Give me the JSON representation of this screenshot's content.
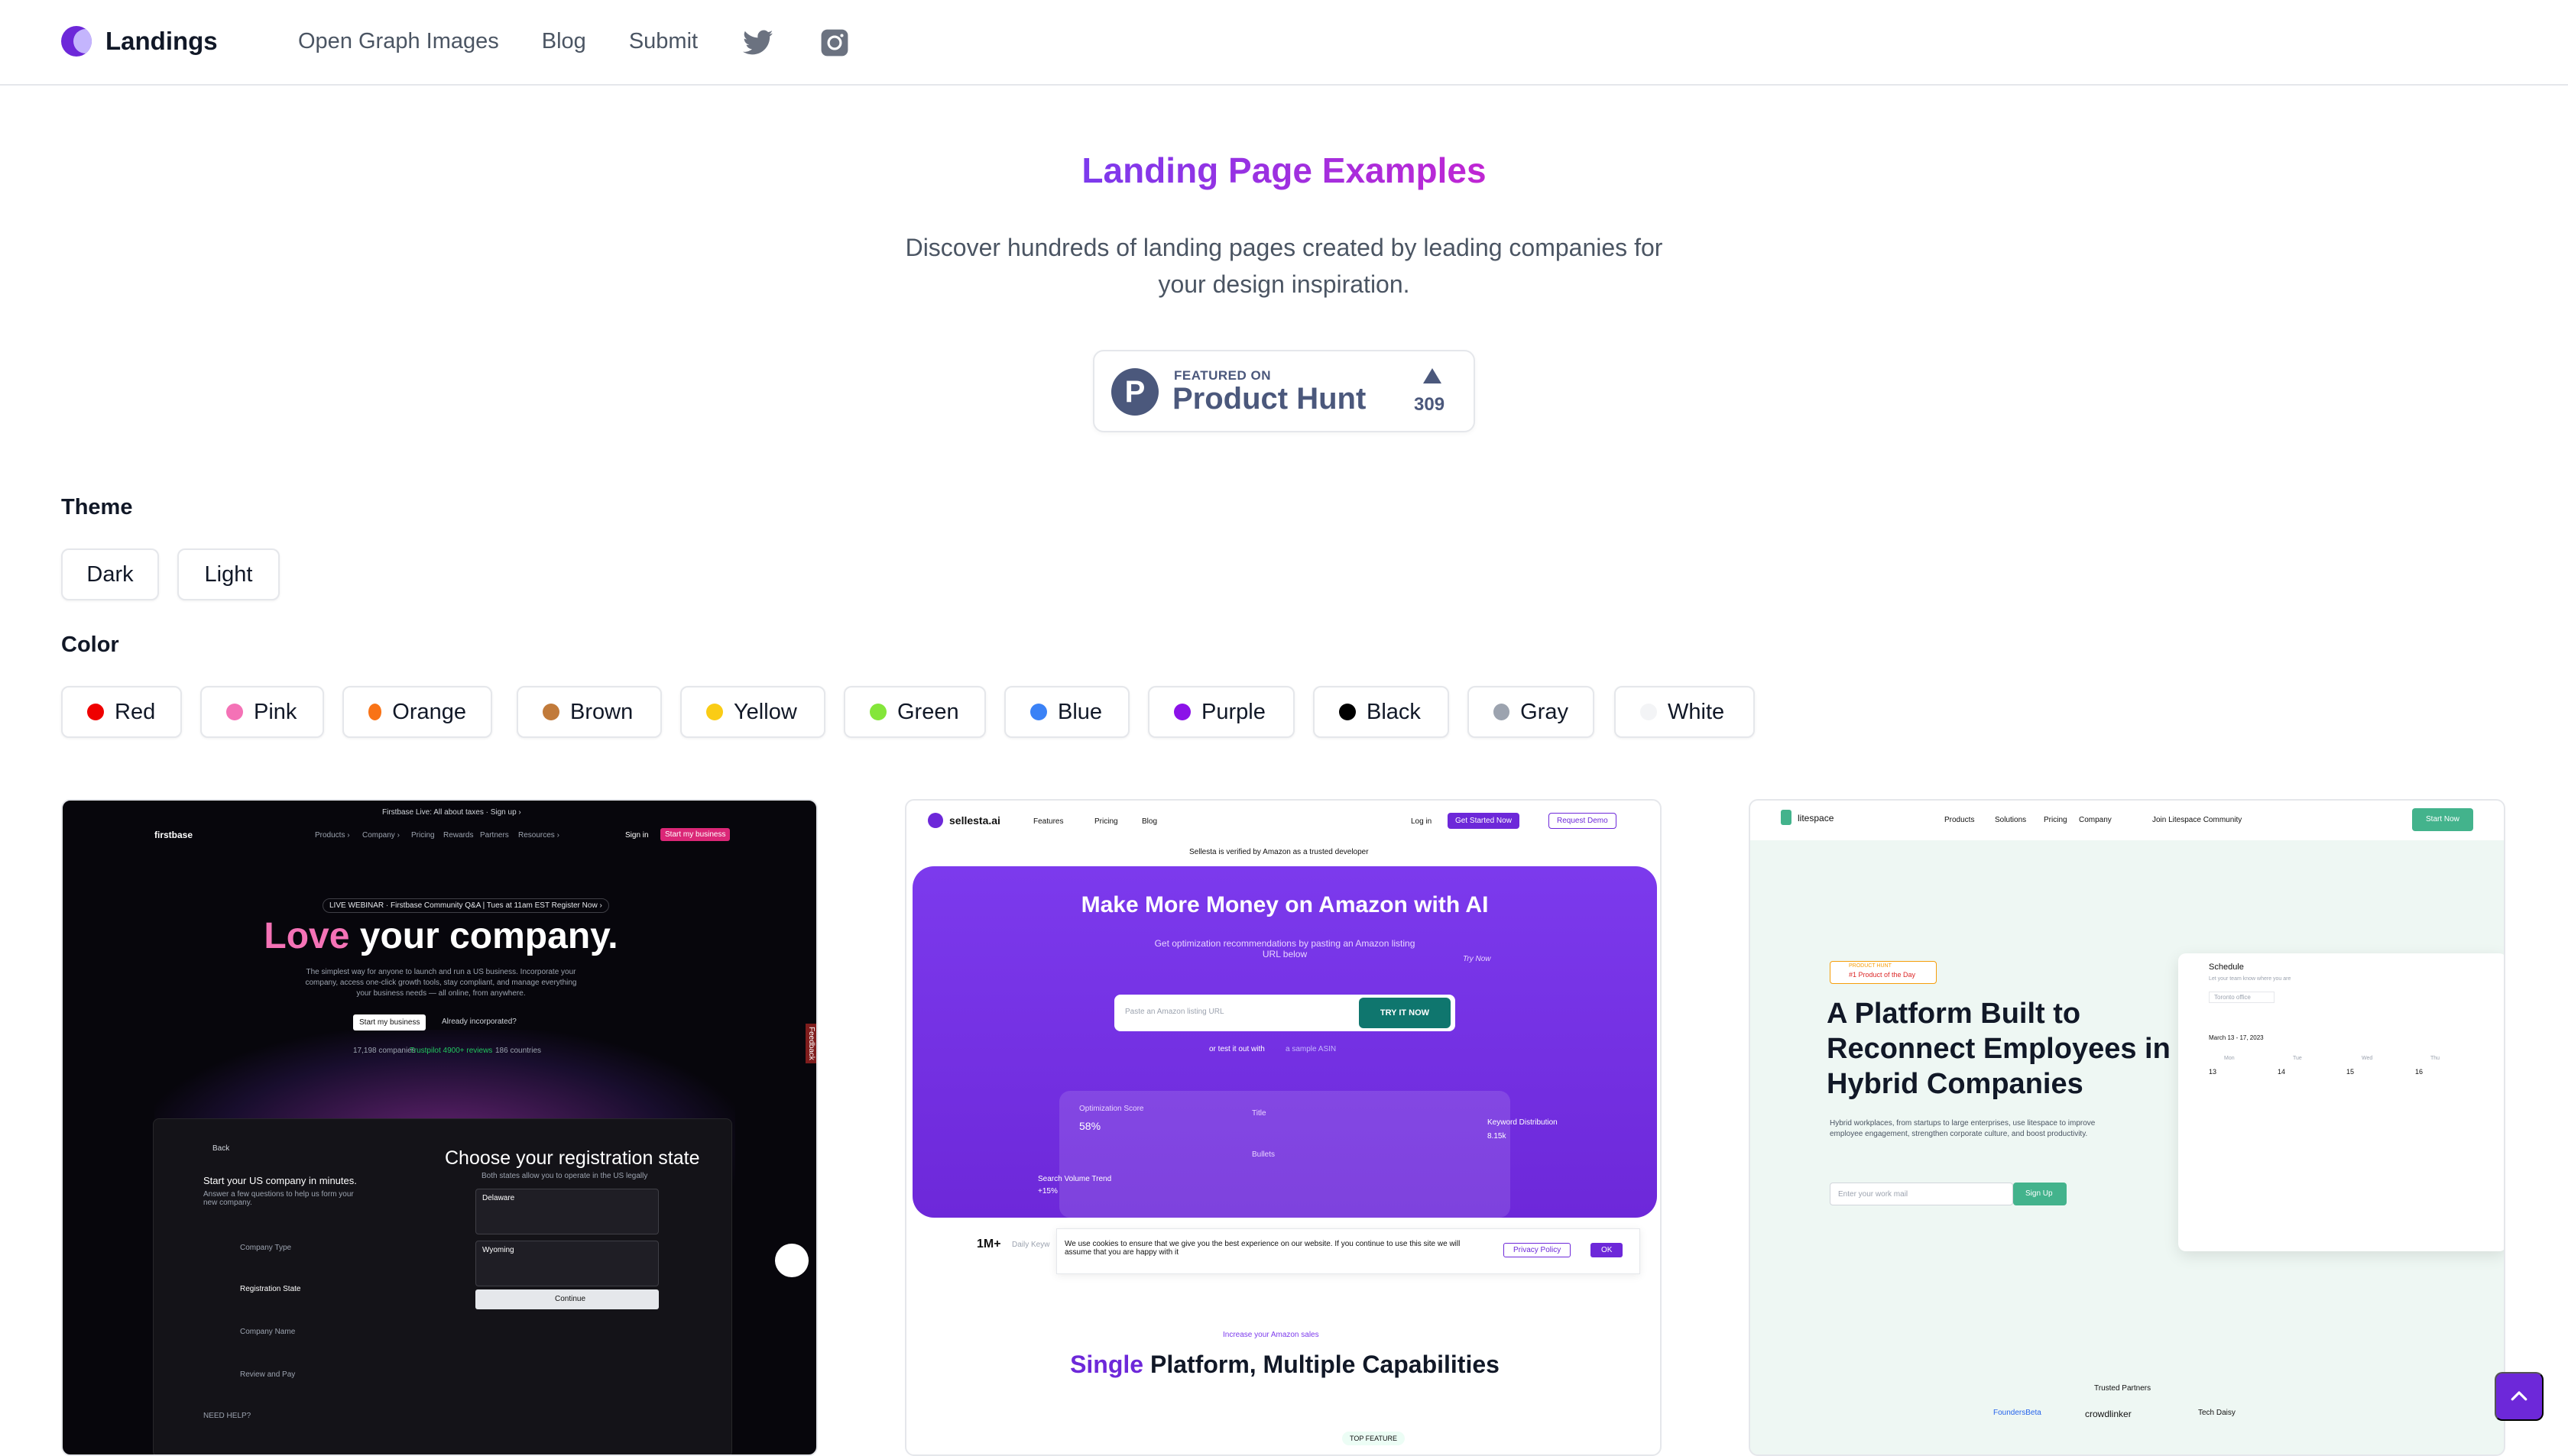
{
  "nav": {
    "brand": "Landings",
    "links": [
      "Open Graph Images",
      "Blog",
      "Submit"
    ],
    "icons": [
      "twitter-icon",
      "instagram-icon"
    ]
  },
  "hero": {
    "title": "Landing Page Examples",
    "subtitle": "Discover hundreds of landing pages created by leading companies for your design inspiration."
  },
  "product_hunt": {
    "featured_on": "FEATURED ON",
    "name": "Product Hunt",
    "upvotes": "309"
  },
  "filters": {
    "theme_label": "Theme",
    "themes": [
      "Dark",
      "Light"
    ],
    "color_label": "Color",
    "colors": [
      {
        "label": "Red",
        "hex": "#ef0000"
      },
      {
        "label": "Pink",
        "hex": "#f472b6"
      },
      {
        "label": "Orange",
        "hex": "#f97316"
      },
      {
        "label": "Brown",
        "hex": "#c17a3a"
      },
      {
        "label": "Yellow",
        "hex": "#facc15"
      },
      {
        "label": "Green",
        "hex": "#84e63a"
      },
      {
        "label": "Blue",
        "hex": "#3b82f6"
      },
      {
        "label": "Purple",
        "hex": "#8b12e8"
      },
      {
        "label": "Black",
        "hex": "#000000"
      },
      {
        "label": "Gray",
        "hex": "#9ca3af"
      },
      {
        "label": "White",
        "hex": "#f3f4f6"
      }
    ]
  },
  "cards": [
    {
      "brand": "firstbase",
      "banner": "Firstbase Live: All about taxes · Sign up ›",
      "nav": [
        "Products ›",
        "Company ›",
        "Pricing",
        "Rewards",
        "Partners",
        "Resources ›",
        "Sign in",
        "Start my business"
      ],
      "pill": "LIVE WEBINAR · Firstbase Community Q&A | Tues at 11am EST Register Now ›",
      "headline_accent": "Love",
      "headline_rest": " your company.",
      "body": "The simplest way for anyone to launch and run a US business. Incorporate your company, access one-click growth tools, stay compliant, and manage everything your business needs — all online, from anywhere.",
      "primary_cta": "Start my business",
      "secondary_cta": "Already incorporated?",
      "stats": [
        "17,198 companies",
        "Trustpilot 4900+ reviews",
        "186 countries"
      ],
      "panel_title": "Choose your registration state",
      "panel_sub": "Both states allow you to operate in the US legally",
      "left_title": "Start your US company in minutes.",
      "left_sub": "Answer a few questions to help us form your new company.",
      "back": "Back",
      "steps": [
        "Company Type",
        "Registration State",
        "Company Name",
        "Review and Pay"
      ],
      "options": [
        "Delaware",
        "Wyoming"
      ],
      "continue": "Continue",
      "need_help": "NEED HELP?",
      "feedback": "Feedback"
    },
    {
      "brand": "sellesta.ai",
      "nav": [
        "Features",
        "Pricing",
        "Blog",
        "Log in",
        "Get Started Now",
        "Request Demo"
      ],
      "verified": "Sellesta is verified by Amazon as a trusted developer",
      "headline": "Make More Money on Amazon with AI",
      "sub": "Get optimization recommendations by pasting an Amazon listing URL below",
      "try_now": "Try Now",
      "input_placeholder": "Paste an Amazon listing URL",
      "cta": "TRY IT NOW",
      "alt": "or test it out with",
      "alt_link": "a sample ASIN",
      "dash_label": "Optimization Score",
      "dash_value": "58%",
      "dash_fields": [
        "Title",
        "Bullets"
      ],
      "kw_label": "Keyword Distribution",
      "kw_value": "8.15k",
      "trend_label": "Search Volume Trend",
      "trend_value": "+15%",
      "stat": "1M+",
      "stat_label": "Daily Keyw",
      "cookie": "We use cookies to ensure that we give you the best experience on our website. If you continue to use this site we will assume that you are happy with it",
      "privacy": "Privacy Policy",
      "ok": "OK",
      "eyebrow": "Increase your Amazon sales",
      "section_accent": "Single",
      "section_rest": " Platform, Multiple Capabilities",
      "tag": "TOP FEATURE"
    },
    {
      "brand": "litespace",
      "nav": [
        "Products",
        "Solutions",
        "Pricing",
        "Company",
        "Join Litespace Community",
        "Start Now"
      ],
      "badge_top": "PRODUCT HUNT",
      "badge_main": "#1 Product of the Day",
      "headline": "A Platform Built to Reconnect Employees in Hybrid Companies",
      "body": "Hybrid workplaces, from startups to large enterprises, use litespace to improve employee engagement, strengthen corporate culture, and boost productivity.",
      "email_placeholder": "Enter your work mail",
      "signup": "Sign Up",
      "app_title": "Schedule",
      "app_sub": "Let your team know where you are",
      "app_select": "Toronto office",
      "app_range": "March 13 - 17, 2023",
      "days": [
        "Mon",
        "Tue",
        "Wed",
        "Thu"
      ],
      "dates": [
        "13",
        "14",
        "15",
        "16"
      ],
      "trusted": "Trusted Partners",
      "partners": [
        "FoundersBeta",
        "crowdlinker",
        "Tech Daisy"
      ]
    }
  ]
}
